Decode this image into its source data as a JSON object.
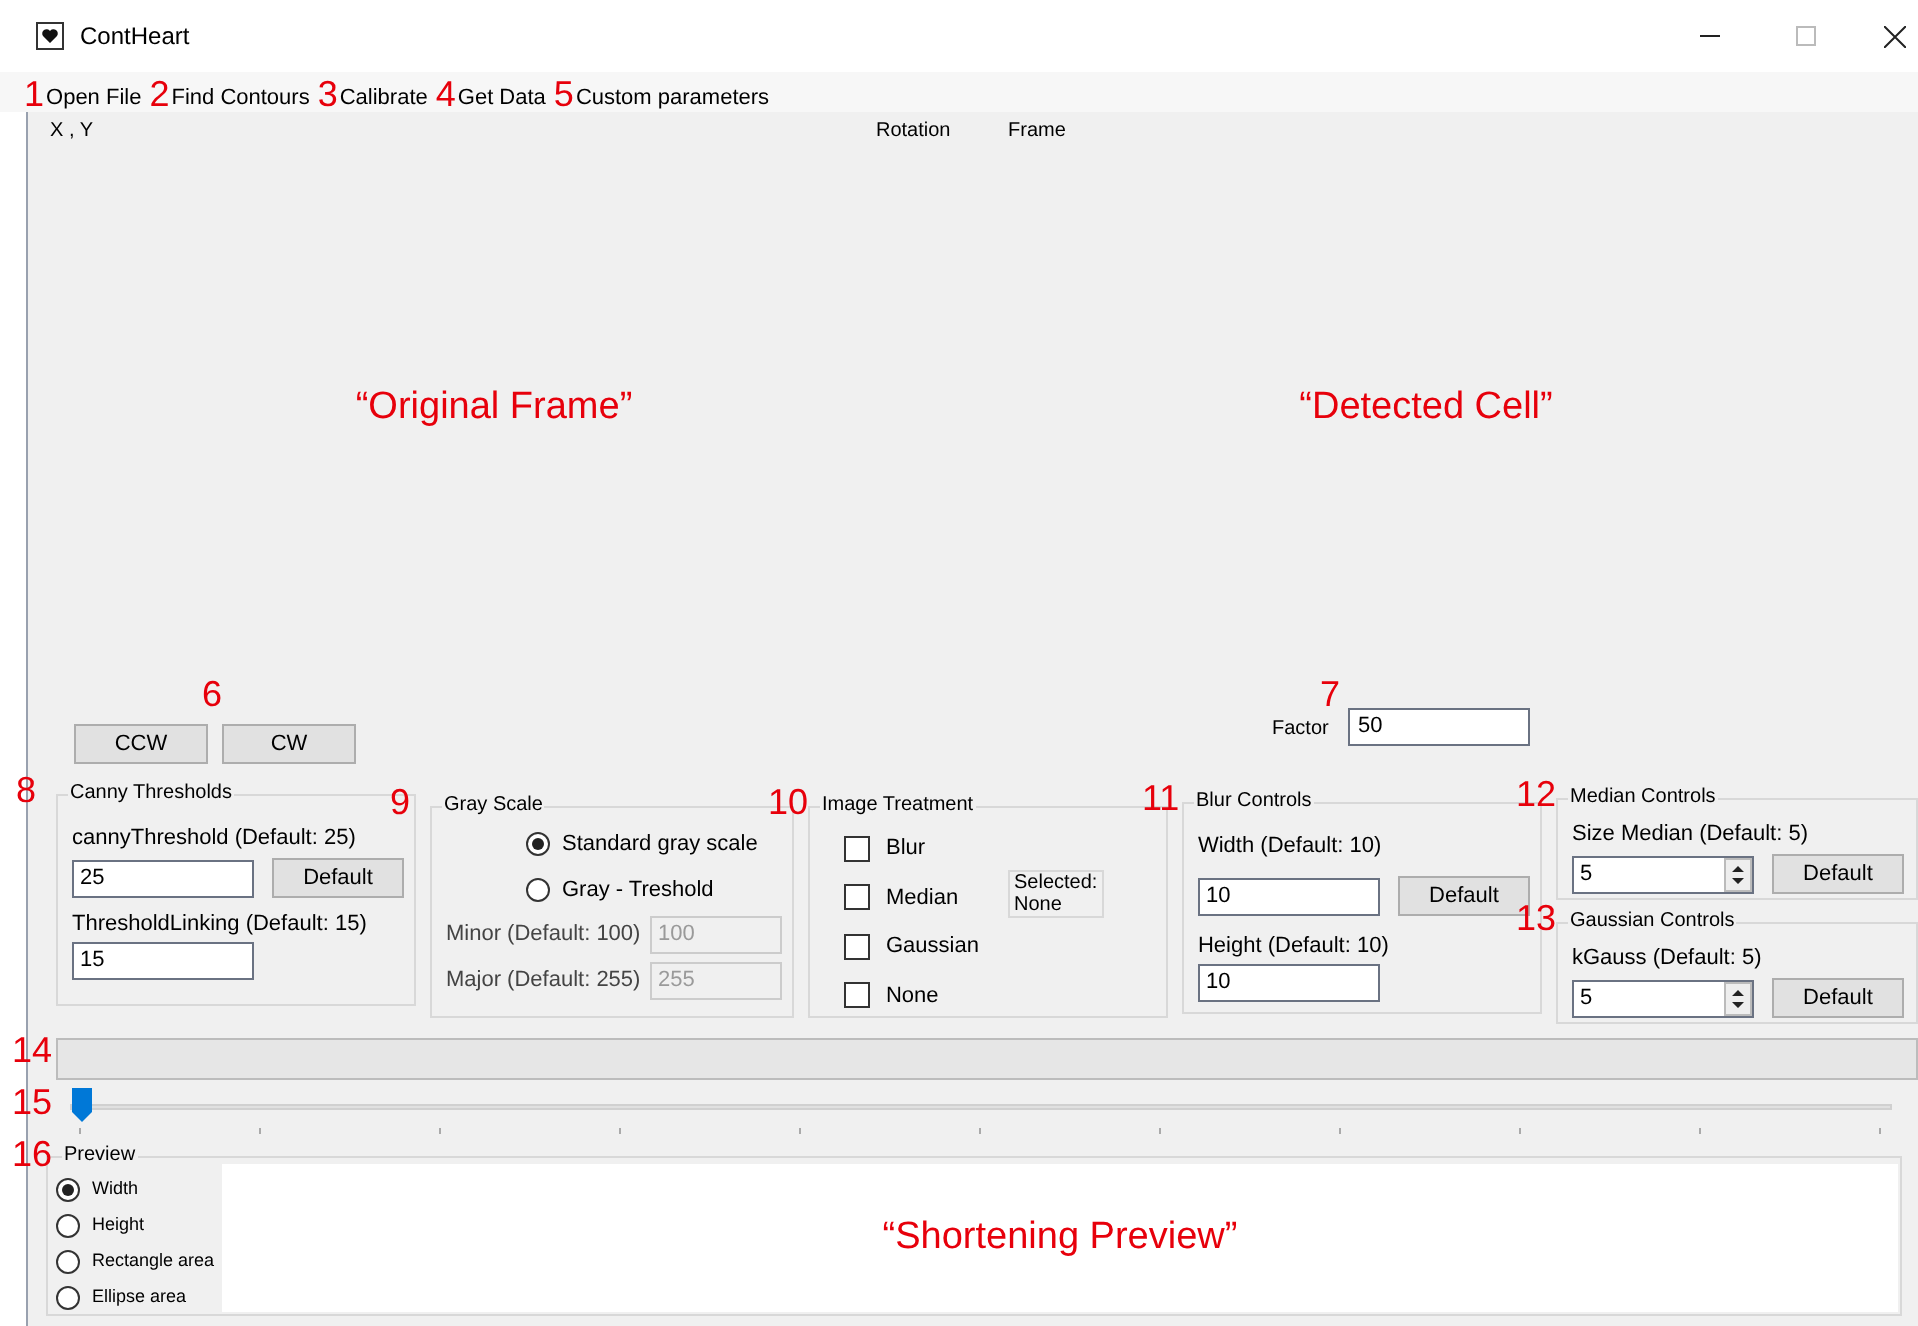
{
  "window": {
    "title": "ContHeart"
  },
  "menu": [
    {
      "marker": "1",
      "label": "Open File"
    },
    {
      "marker": "2",
      "label": "Find Contours"
    },
    {
      "marker": "3",
      "label": "Calibrate"
    },
    {
      "marker": "4",
      "label": "Get Data"
    },
    {
      "marker": "5",
      "label": "Custom parameters"
    }
  ],
  "header": {
    "coords_label": "X , Y",
    "rotation_label": "Rotation",
    "frame_label": "Frame"
  },
  "image_panels": [
    {
      "caption": "“Original Frame”"
    },
    {
      "caption": "“Detected Cell”"
    }
  ],
  "rotation": {
    "marker": "6",
    "buttons": [
      "CCW",
      "CW"
    ]
  },
  "factor": {
    "marker": "7",
    "label": "Factor",
    "value": "50"
  },
  "canny": {
    "marker": "8",
    "title": "Canny Thresholds",
    "threshold_label": "cannyThreshold (Default: 25)",
    "threshold_value": "25",
    "default_button": "Default",
    "linking_label": "ThresholdLinking (Default: 15)",
    "linking_value": "15"
  },
  "gray_scale": {
    "marker": "9",
    "title": "Gray Scale",
    "options": [
      {
        "label": "Standard gray scale",
        "selected": true
      },
      {
        "label": "Gray - Treshold",
        "selected": false
      }
    ],
    "minor_label": "Minor (Default: 100)",
    "minor_value": "100",
    "major_label": "Major (Default: 255)",
    "major_value": "255",
    "fields_disabled": true
  },
  "image_treatment": {
    "marker": "10",
    "title": "Image Treatment",
    "options": [
      {
        "label": "Blur",
        "checked": false
      },
      {
        "label": "Median",
        "checked": false
      },
      {
        "label": "Gaussian",
        "checked": false
      },
      {
        "label": "None",
        "checked": false
      }
    ],
    "selected_text": "Selected: None"
  },
  "blur": {
    "marker": "11",
    "title": "Blur Controls",
    "width_label": "Width (Default: 10)",
    "width_value": "10",
    "default_button": "Default",
    "height_label": "Height (Default: 10)",
    "height_value": "10"
  },
  "median": {
    "marker": "12",
    "title": "Median Controls",
    "label": "Size Median (Default: 5)",
    "value": "5",
    "default_button": "Default"
  },
  "gaussian": {
    "marker": "13",
    "title": "Gaussian Controls",
    "label": "kGauss (Default: 5)",
    "value": "5",
    "default_button": "Default"
  },
  "progress": {
    "marker": "14",
    "level": 0
  },
  "slider": {
    "marker": "15",
    "level": 0
  },
  "preview": {
    "marker": "16",
    "title": "Preview",
    "options": [
      {
        "label": "Width",
        "selected": true
      },
      {
        "label": "Height",
        "selected": false
      },
      {
        "label": "Rectangle area",
        "selected": false
      },
      {
        "label": "Ellipse area",
        "selected": false
      }
    ],
    "caption": "“Shortening Preview”"
  }
}
